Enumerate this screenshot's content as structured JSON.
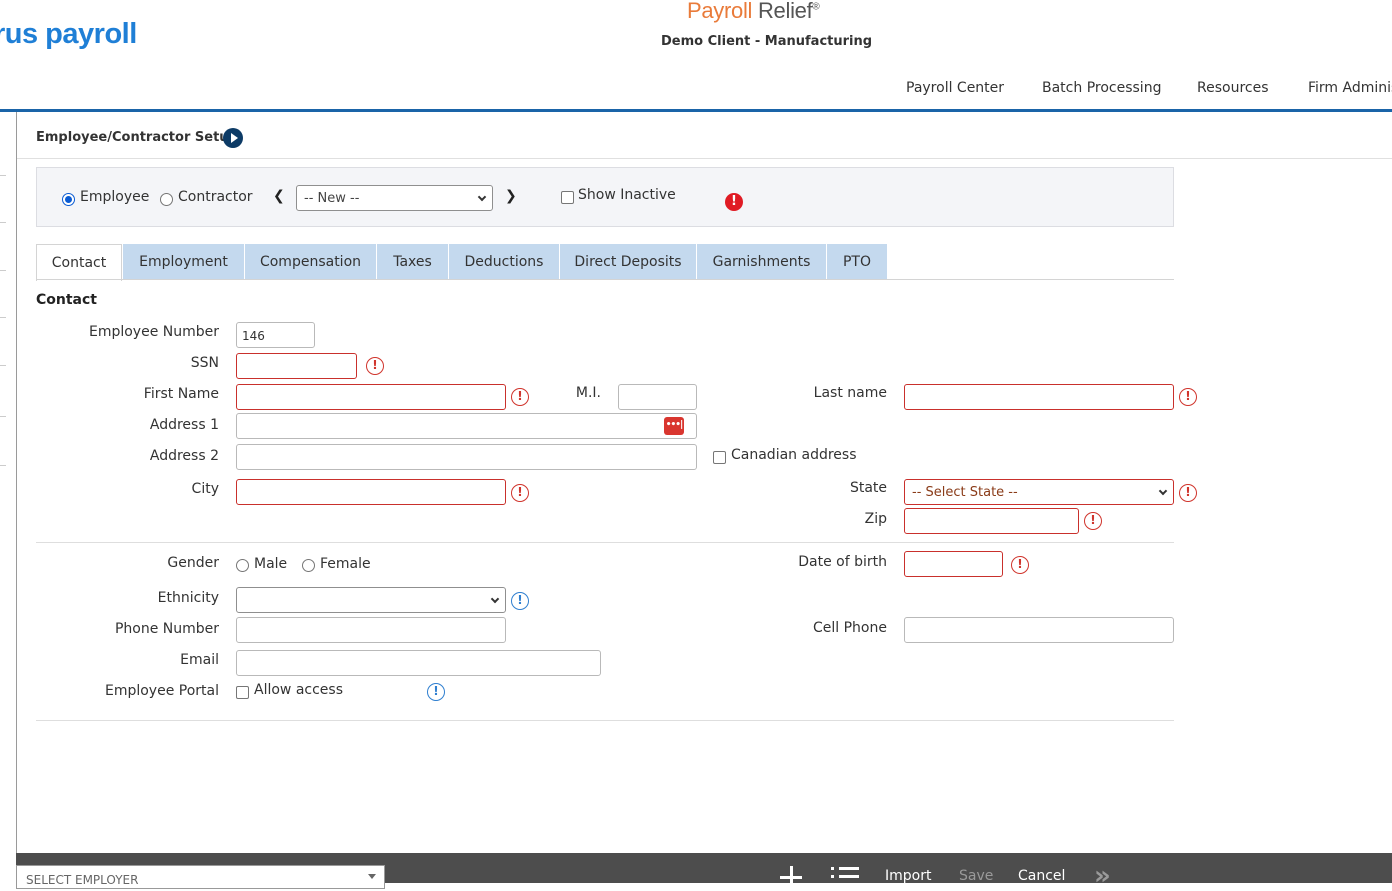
{
  "header": {
    "brand": "rus payroll",
    "product_part1": "Payroll",
    "product_part2": "Relief",
    "product_mark": "®",
    "client": "Demo Client - Manufacturing",
    "nav": [
      "Payroll Center",
      "Batch Processing",
      "Resources",
      "Firm Adminis"
    ]
  },
  "page": {
    "title": "Employee/Contractor Setup"
  },
  "selector": {
    "type_options": [
      {
        "label": "Employee",
        "selected": true
      },
      {
        "label": "Contractor",
        "selected": false
      }
    ],
    "employee_select_value": "-- New --",
    "show_inactive_label": "Show Inactive",
    "warning_glyph": "!"
  },
  "tabs": [
    {
      "label": "Contact",
      "active": true
    },
    {
      "label": "Employment",
      "active": false
    },
    {
      "label": "Compensation",
      "active": false
    },
    {
      "label": "Taxes",
      "active": false
    },
    {
      "label": "Deductions",
      "active": false
    },
    {
      "label": "Direct Deposits",
      "active": false
    },
    {
      "label": "Garnishments",
      "active": false
    },
    {
      "label": "PTO",
      "active": false
    }
  ],
  "contact": {
    "section_title": "Contact",
    "employee_number_label": "Employee Number",
    "employee_number_value": "146",
    "ssn_label": "SSN",
    "first_name_label": "First Name",
    "mi_label": "M.I.",
    "last_name_label": "Last name",
    "address1_label": "Address 1",
    "address_icon_text": "•••|",
    "address2_label": "Address 2",
    "canadian_address_label": "Canadian address",
    "city_label": "City",
    "state_label": "State",
    "state_placeholder": "-- Select State --",
    "zip_label": "Zip",
    "gender_label": "Gender",
    "gender_male": "Male",
    "gender_female": "Female",
    "dob_label": "Date of birth",
    "ethnicity_label": "Ethnicity",
    "phone_label": "Phone Number",
    "cell_label": "Cell Phone",
    "email_label": "Email",
    "portal_label": "Employee Portal",
    "allow_access_label": "Allow access",
    "alert_glyph": "!",
    "info_glyph": "!"
  },
  "footer": {
    "employer_placeholder": "SELECT EMPLOYER",
    "import_label": "Import",
    "save_label": "Save",
    "cancel_label": "Cancel",
    "more_glyph": "»"
  },
  "colors": {
    "brand_blue": "#1f7fd6",
    "product_orange": "#e97b3a",
    "nav_rule": "#1a64a8",
    "tab_inactive": "#c4d9ee",
    "required_red": "#c9302c",
    "info_blue": "#2f7fd0",
    "footer_bg": "#4d4d4d"
  }
}
